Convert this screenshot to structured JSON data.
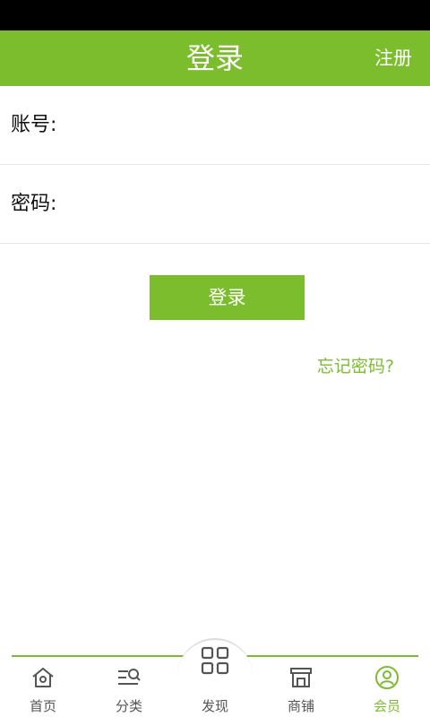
{
  "header": {
    "title": "登录",
    "register_label": "注册"
  },
  "form": {
    "account_label": "账号:",
    "account_value": "",
    "password_label": "密码:",
    "password_value": ""
  },
  "login_button_label": "登录",
  "forgot_password_label": "忘记密码?",
  "tabbar": {
    "items": [
      {
        "label": "首页",
        "icon": "home-icon"
      },
      {
        "label": "分类",
        "icon": "category-icon"
      },
      {
        "label": "发现",
        "icon": "grid-icon"
      },
      {
        "label": "商铺",
        "icon": "shop-icon"
      },
      {
        "label": "会员",
        "icon": "user-circle-icon",
        "active": true
      }
    ]
  },
  "colors": {
    "accent": "#7cbd2e",
    "status_bar": "#000000",
    "text": "#111111",
    "tab_text": "#555555"
  }
}
